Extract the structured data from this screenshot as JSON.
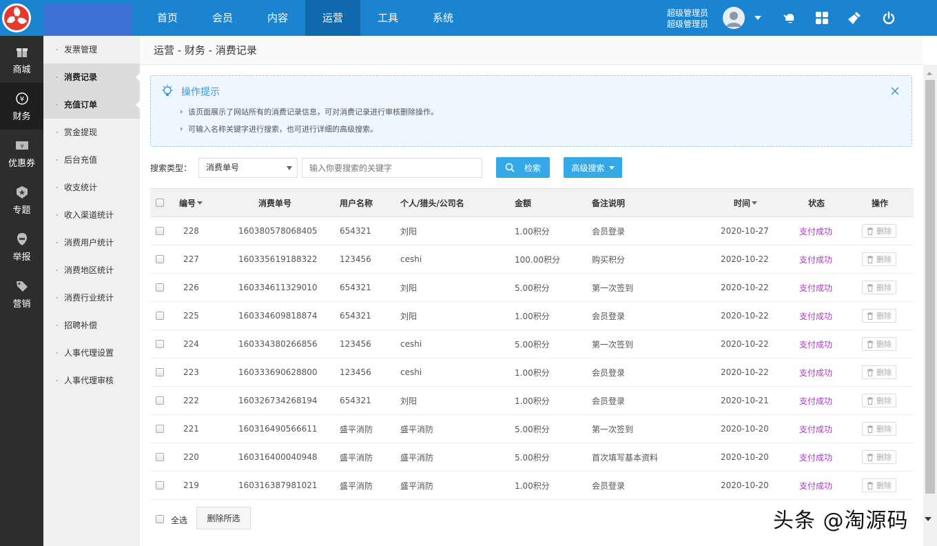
{
  "topnav": {
    "items": [
      "首页",
      "会员",
      "内容",
      "运营",
      "工具",
      "系统"
    ],
    "active_index": 3,
    "user_line1": "超级管理员",
    "user_line2": "超级管理员"
  },
  "iconbar": {
    "items": [
      {
        "label": "商城",
        "icon": "gift-icon"
      },
      {
        "label": "财务",
        "icon": "yen-icon"
      },
      {
        "label": "优惠券",
        "icon": "coupon-icon"
      },
      {
        "label": "专题",
        "icon": "badge-icon"
      },
      {
        "label": "举报",
        "icon": "report-icon"
      },
      {
        "label": "营销",
        "icon": "tag-icon"
      }
    ],
    "active_index": 1
  },
  "submenu": {
    "items": [
      "发票管理",
      "消费记录",
      "充值订单",
      "赏金提现",
      "后台充值",
      "收支统计",
      "收入渠道统计",
      "消费用户统计",
      "消费地区统计",
      "消费行业统计",
      "招聘补偿",
      "人事代理设置",
      "人事代理审核"
    ]
  },
  "breadcrumb": "运营 - 财务 - 消费记录",
  "tips": {
    "title": "操作提示",
    "lines": [
      "该页面展示了网站所有的消费记录信息，可对消费记录进行审核删除操作。",
      "可输入名称关键字进行搜索，也可进行详细的高级搜索。"
    ]
  },
  "search": {
    "label": "搜索类型：",
    "type_value": "消费单号",
    "placeholder": "输入你要搜索的关键字",
    "search_button": "检索",
    "advanced_button": "高级搜索"
  },
  "table": {
    "headers": {
      "id": "编号",
      "no": "消费单号",
      "user": "用户名称",
      "org": "个人/猎头/公司名",
      "amount": "金额",
      "note": "备注说明",
      "time": "时间",
      "status": "状态",
      "op": "操作"
    },
    "delete_label": "删除",
    "rows": [
      {
        "id": "228",
        "no": "160380578068405",
        "user": "654321",
        "org": "刘阳",
        "amount": "1.00积分",
        "note": "会员登录",
        "time": "2020-10-27",
        "status": "支付成功"
      },
      {
        "id": "227",
        "no": "160335619188322",
        "user": "123456",
        "org": "ceshi",
        "amount": "100.00积分",
        "note": "购买积分",
        "time": "2020-10-22",
        "status": "支付成功"
      },
      {
        "id": "226",
        "no": "160334611329010",
        "user": "654321",
        "org": "刘阳",
        "amount": "5.00积分",
        "note": "第一次签到",
        "time": "2020-10-22",
        "status": "支付成功"
      },
      {
        "id": "225",
        "no": "160334609818874",
        "user": "654321",
        "org": "刘阳",
        "amount": "1.00积分",
        "note": "会员登录",
        "time": "2020-10-22",
        "status": "支付成功"
      },
      {
        "id": "224",
        "no": "160334380266856",
        "user": "123456",
        "org": "ceshi",
        "amount": "5.00积分",
        "note": "第一次签到",
        "time": "2020-10-22",
        "status": "支付成功"
      },
      {
        "id": "223",
        "no": "160333690628800",
        "user": "123456",
        "org": "ceshi",
        "amount": "1.00积分",
        "note": "会员登录",
        "time": "2020-10-22",
        "status": "支付成功"
      },
      {
        "id": "222",
        "no": "160326734268194",
        "user": "654321",
        "org": "刘阳",
        "amount": "1.00积分",
        "note": "会员登录",
        "time": "2020-10-21",
        "status": "支付成功"
      },
      {
        "id": "221",
        "no": "160316490566611",
        "user": "盛平消防",
        "org": "盛平消防",
        "amount": "5.00积分",
        "note": "第一次签到",
        "time": "2020-10-20",
        "status": "支付成功"
      },
      {
        "id": "220",
        "no": "160316400040948",
        "user": "盛平消防",
        "org": "盛平消防",
        "amount": "5.00积分",
        "note": "首次填写基本资料",
        "time": "2020-10-20",
        "status": "支付成功"
      },
      {
        "id": "219",
        "no": "160316387981021",
        "user": "盛平消防",
        "org": "盛平消防",
        "amount": "1.00积分",
        "note": "会员登录",
        "time": "2020-10-20",
        "status": "支付成功"
      }
    ]
  },
  "footer": {
    "select_all": "全选",
    "delete_selected": "删除所选"
  },
  "watermark": "头条 @淘源码",
  "colors": {
    "topbar": "#1b84d1",
    "accent_button": "#35a9e7",
    "status": "#b236c9",
    "sidebar": "#2d2d2d"
  }
}
